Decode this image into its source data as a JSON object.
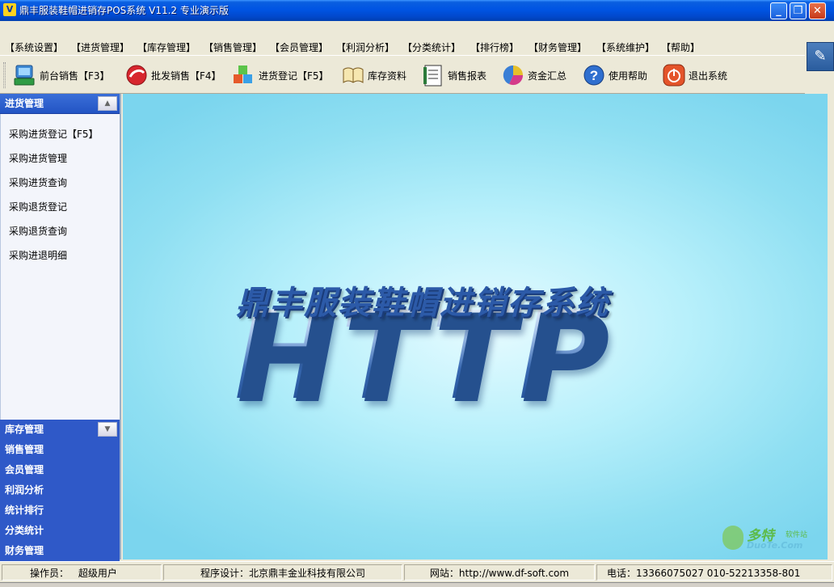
{
  "window": {
    "title": "鼎丰服装鞋帽进销存POS系统 V11.2 专业演示版",
    "app_icon_text": "V",
    "minimize": "_",
    "maximize": "❐",
    "close": "✕"
  },
  "menu": {
    "items": [
      {
        "label": "【系统设置】"
      },
      {
        "label": "【进货管理】"
      },
      {
        "label": "【库存管理】"
      },
      {
        "label": "【销售管理】"
      },
      {
        "label": "【会员管理】"
      },
      {
        "label": "【利润分析】"
      },
      {
        "label": "【分类统计】"
      },
      {
        "label": "【排行榜】"
      },
      {
        "label": "【财务管理】"
      },
      {
        "label": "【系统维护】"
      },
      {
        "label": "【帮助】"
      }
    ]
  },
  "toolbar": {
    "buttons": [
      {
        "label": "前台销售【F3】",
        "icon": "pos-terminal-icon"
      },
      {
        "label": "批发销售【F4】",
        "icon": "wholesale-icon"
      },
      {
        "label": "进货登记【F5】",
        "icon": "cubes-icon"
      },
      {
        "label": "库存资料",
        "icon": "book-icon"
      },
      {
        "label": "销售报表",
        "icon": "report-icon"
      },
      {
        "label": "资金汇总",
        "icon": "pie-chart-icon"
      },
      {
        "label": "使用帮助",
        "icon": "help-icon"
      },
      {
        "label": "退出系统",
        "icon": "power-icon"
      }
    ]
  },
  "sidebar": {
    "active_section": "进货管理",
    "active_links": [
      "采购进货登记【F5】",
      "采购进货管理",
      "采购进货查询",
      "采购退货登记",
      "采购退货查询",
      "采购进退明细"
    ],
    "sections": [
      "库存管理",
      "销售管理",
      "会员管理",
      "利润分析",
      "统计排行",
      "分类统计",
      "财务管理"
    ]
  },
  "main": {
    "splash_title": "鼎丰服装鞋帽进销存系统",
    "splash_logo": "HTTP",
    "watermark_cn": "多特",
    "watermark_sub": "软件站",
    "watermark_en": "DuoTe.Com"
  },
  "status": {
    "operator_label": "操作员：",
    "operator_value": "超级用户",
    "designer": "程序设计：北京鼎丰金业科技有限公司",
    "website": "网站：http://www.df-soft.com",
    "phone": "电话：13366075027 010-52213358-801"
  },
  "colors": {
    "titlebar": "#0054e3",
    "sidebar_header": "#2f59c8",
    "main_background": "#8fdff2"
  }
}
